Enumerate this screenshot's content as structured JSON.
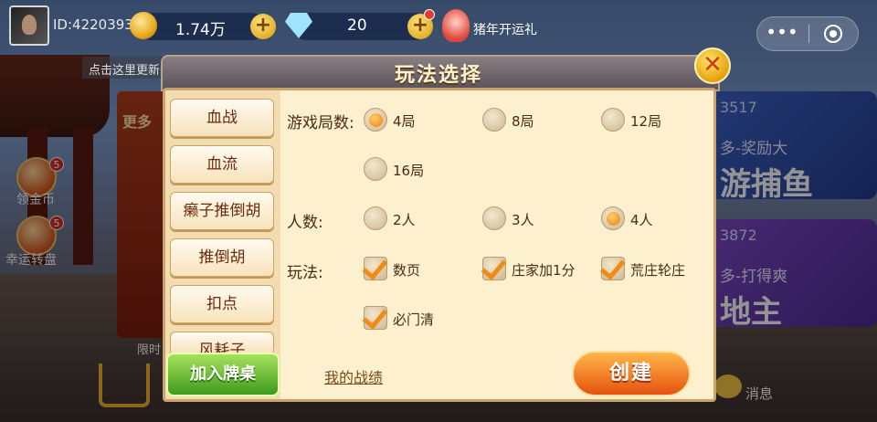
{
  "header": {
    "player_id": "ID:4220393",
    "coin_value": "1.74万",
    "gem_value": "20",
    "pig_event_label": "猪年开运礼",
    "name_hint": "点击这里更新头像和名称哟~"
  },
  "background": {
    "left_panel_text": "更多",
    "left_tag_text": "限时",
    "side_items": [
      {
        "label": "领金币",
        "badge": "5"
      },
      {
        "label": "幸运转盘",
        "badge": "5"
      }
    ],
    "cards": [
      {
        "number": "3517",
        "sub": "多-奖励大",
        "title": "游捕鱼"
      },
      {
        "number": "3872",
        "sub": "多-打得爽",
        "title": "地主"
      }
    ],
    "message_label": "消息"
  },
  "dialog": {
    "title": "玩法选择",
    "close_glyph": "✕",
    "categories": [
      "血战",
      "血流",
      "癞子推倒胡",
      "推倒胡",
      "扣点",
      "风耗子"
    ],
    "rounds": {
      "label": "游戏局数:",
      "options": [
        "4局",
        "8局",
        "12局",
        "16局"
      ],
      "selected": "4局"
    },
    "players": {
      "label": "人数:",
      "options": [
        "2人",
        "3人",
        "4人"
      ],
      "selected": "4人"
    },
    "rules": {
      "label": "玩法:",
      "options": [
        {
          "label": "数页",
          "checked": true
        },
        {
          "label": "庄家加1分",
          "checked": true
        },
        {
          "label": "荒庄轮庄",
          "checked": true
        },
        {
          "label": "必门清",
          "checked": true
        }
      ]
    },
    "join_label": "加入牌桌",
    "record_label": "我的战绩",
    "create_label": "创建"
  },
  "icons": {
    "avatar": "avatar-icon",
    "coin": "coin-icon",
    "gem": "diamond-icon",
    "plus": "plus-icon",
    "pig": "pig-gift-icon",
    "more": "more-icon",
    "close": "close-icon",
    "message": "message-icon",
    "shop": "shop-cart-icon"
  },
  "colors": {
    "accent_orange": "#f07a10",
    "join_green": "#3f9a1c",
    "create_orange": "#e5520e",
    "dialog_bg": "#fdf0cf"
  }
}
